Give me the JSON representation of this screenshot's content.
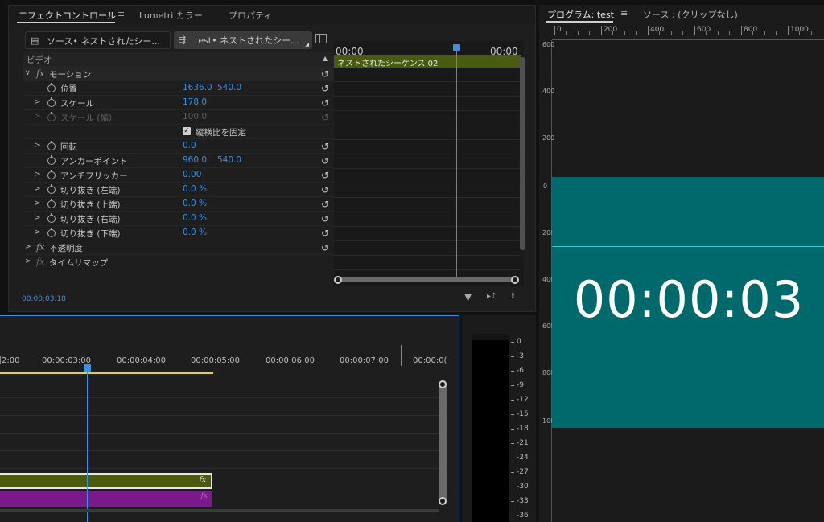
{
  "effect_controls": {
    "tabs": [
      "エフェクトコントロール",
      "Lumetri カラー",
      "プロパティ"
    ],
    "menu_glyph": "≡",
    "source_tab": "ソース• ネストされたシー...",
    "sequence_tab": "test• ネストされたシー...",
    "section_video": "ビデオ",
    "rows": {
      "motion": "モーション",
      "position": {
        "label": "位置",
        "x": "1636.0",
        "y": "540.0"
      },
      "scale": {
        "label": "スケール",
        "value": "178.0"
      },
      "scale_width": {
        "label": "スケール (幅)",
        "value": "100.0"
      },
      "uniform": "縦横比を固定",
      "rotation": {
        "label": "回転",
        "value": "0.0"
      },
      "anchor": {
        "label": "アンカーポイント",
        "x": "960.0",
        "y": "540.0"
      },
      "antiflicker": {
        "label": "アンチフリッカー",
        "value": "0.00"
      },
      "crop_left": {
        "label": "切り抜き (左端)",
        "value": "0.0 %"
      },
      "crop_top": {
        "label": "切り抜き (上端)",
        "value": "0.0 %"
      },
      "crop_right": {
        "label": "切り抜き (右端)",
        "value": "0.0 %"
      },
      "crop_bottom": {
        "label": "切り抜き (下端)",
        "value": "0.0 %"
      },
      "opacity": "不透明度",
      "time_remap": "タイムリマップ"
    },
    "mini_timeline": {
      "tc_left": "00;00",
      "tc_right": "00;00",
      "clip_name": "ネストされたシーケンス 02"
    },
    "current_time": "00:00:03:18"
  },
  "program": {
    "tabs": [
      "プログラム: test",
      "ソース : (クリップなし)"
    ],
    "menu_glyph": "≡",
    "ruler_h": [
      "0",
      "200",
      "400",
      "600",
      "800",
      "1000"
    ],
    "ruler_v": [
      "600",
      "400",
      "200",
      "0",
      "200",
      "400",
      "600",
      "800",
      "1000"
    ],
    "timecode": "00:00:03"
  },
  "timeline": {
    "ticks": [
      "2:00",
      "00:00:03:00",
      "00:00:04:00",
      "00:00:05:00",
      "00:00:06:00",
      "00:00:07:00",
      "00:00:0("
    ],
    "fx": "fx"
  },
  "meter": {
    "labels": [
      "0",
      "-3",
      "-6",
      "-9",
      "-12",
      "-15",
      "-18",
      "-21",
      "-24",
      "-27",
      "-30",
      "-33",
      "-36"
    ]
  },
  "colors": {
    "accent": "#3d8fe0",
    "video_clip": "#4a5a0e",
    "audio_clip": "#7b1a8a",
    "teal": "#00696c"
  }
}
